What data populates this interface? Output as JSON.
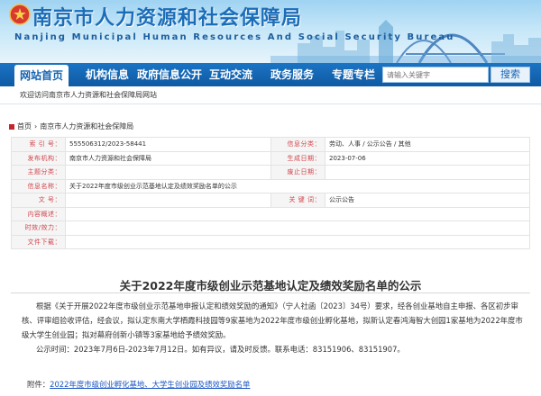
{
  "header": {
    "title": "南京市人力资源和社会保障局",
    "subtitle": "Nanjing Municipal Human Resources And Social Security Bureau"
  },
  "nav": {
    "items": [
      "网站首页",
      "机构信息",
      "政府信息公开",
      "互动交流",
      "政务服务",
      "专题专栏"
    ],
    "search_placeholder": "请输入关键字",
    "search_button": "搜索"
  },
  "welcome": "欢迎访问南京市人力资源和社会保障局网站",
  "breadcrumb": {
    "home": "首页",
    "current": "南京市人力资源和社会保障局"
  },
  "info": {
    "index_no_label": "索 引 号：",
    "index_no": "555506312/2023-58441",
    "category_label": "信息分类：",
    "category": "劳动、人事 / 公示公告 / 其他",
    "publisher_label": "发布机构：",
    "publisher": "南京市人力资源和社会保障局",
    "created_label": "生成日期：",
    "created": "2023-07-06",
    "topic_label": "主题分类：",
    "topic": "",
    "abolished_label": "废止日期：",
    "abolished": "",
    "name_label": "信息名称：",
    "name": "关于2022年度市级创业示范基地认定及绩效奖励名单的公示",
    "docno_label": "文   号：",
    "docno": "",
    "keyword_label": "关 键 词：",
    "keyword": "公示公告",
    "summary_label": "内容概述：",
    "summary": "",
    "validity_label": "时效/效力：",
    "validity": "",
    "attachment_label": "文件下载：",
    "attachment": ""
  },
  "article": {
    "title": "关于2022年度市级创业示范基地认定及绩效奖励名单的公示",
    "paragraph1": "根据《关于开展2022年度市级创业示范基地申报认定和绩效奖励的通知》（宁人社函〔2023〕34号）要求，经各创业基地自主申报、各区初步审核、评审组验收评估，经会议，拟认定东南大学栖霞科技园等9家基地为2022年度市级创业孵化基地，拟新认定春鸿海智大创园1家基地为2022年度市级大学生创业园；拟对幕府创新小镇等3家基地给予绩效奖励。",
    "paragraph2": "公示时间：2023年7月6日-2023年7月12日。如有异议，请及时反馈。联系电话：83151906、83151907。",
    "attachment_prefix": "附件：",
    "attachment_link": "2022年度市级创业孵化基地、大学生创业园及绩效奖励名单"
  }
}
